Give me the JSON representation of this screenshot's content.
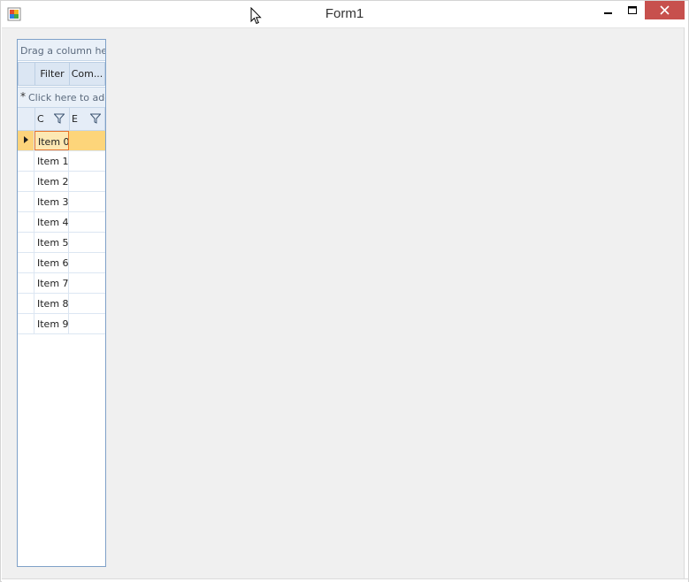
{
  "window": {
    "title": "Form1"
  },
  "grid": {
    "group_panel_text": "Drag a column header here to group by that column",
    "band_headers": [
      "Filter",
      "Com..."
    ],
    "new_row_text": "Click here to add a new row",
    "new_row_symbol": "*",
    "columns": [
      "C",
      "E"
    ],
    "rows": [
      "Item 0",
      "Item 1",
      "Item 2",
      "Item 3",
      "Item 4",
      "Item 5",
      "Item 6",
      "Item 7",
      "Item 8",
      "Item 9"
    ],
    "current_row": 0
  }
}
